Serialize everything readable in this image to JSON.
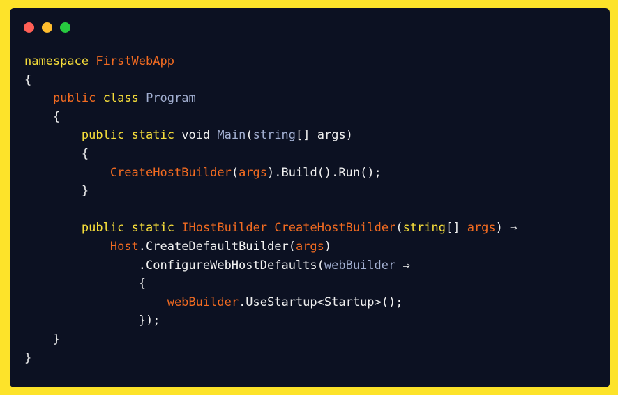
{
  "window": {
    "controls": [
      "close",
      "minimize",
      "maximize"
    ]
  },
  "colors": {
    "background": "#fde32a",
    "editor": "#0c1122",
    "keyword": "#f7de3a",
    "type": "#a3b0d2",
    "identifier": "#f26b21",
    "text": "#f0f0f0"
  },
  "code": {
    "lines": [
      [
        {
          "c": "kw",
          "t": "namespace"
        },
        {
          "c": "pl",
          "t": " "
        },
        {
          "c": "fn",
          "t": "FirstWebApp"
        }
      ],
      [
        {
          "c": "pl",
          "t": "{"
        }
      ],
      [
        {
          "c": "pl",
          "t": "    "
        },
        {
          "c": "fn",
          "t": "public"
        },
        {
          "c": "pl",
          "t": " "
        },
        {
          "c": "kw",
          "t": "class"
        },
        {
          "c": "pl",
          "t": " "
        },
        {
          "c": "ty",
          "t": "Program"
        }
      ],
      [
        {
          "c": "pl",
          "t": "    {"
        }
      ],
      [
        {
          "c": "pl",
          "t": "        "
        },
        {
          "c": "kw",
          "t": "public"
        },
        {
          "c": "pl",
          "t": " "
        },
        {
          "c": "kw",
          "t": "static"
        },
        {
          "c": "pl",
          "t": " void "
        },
        {
          "c": "ty",
          "t": "Main"
        },
        {
          "c": "pl",
          "t": "("
        },
        {
          "c": "ty",
          "t": "string"
        },
        {
          "c": "pl",
          "t": "[] args)"
        }
      ],
      [
        {
          "c": "pl",
          "t": "        {"
        }
      ],
      [
        {
          "c": "pl",
          "t": "            "
        },
        {
          "c": "fn",
          "t": "CreateHostBuilder"
        },
        {
          "c": "pl",
          "t": "("
        },
        {
          "c": "fn",
          "t": "args"
        },
        {
          "c": "pl",
          "t": ").Build().Run();"
        }
      ],
      [
        {
          "c": "pl",
          "t": "        }"
        }
      ],
      [
        {
          "c": "pl",
          "t": ""
        }
      ],
      [
        {
          "c": "pl",
          "t": "        "
        },
        {
          "c": "kw",
          "t": "public"
        },
        {
          "c": "pl",
          "t": " "
        },
        {
          "c": "kw",
          "t": "static"
        },
        {
          "c": "pl",
          "t": " "
        },
        {
          "c": "fn",
          "t": "IHostBuilder"
        },
        {
          "c": "pl",
          "t": " "
        },
        {
          "c": "fn",
          "t": "CreateHostBuilder"
        },
        {
          "c": "pl",
          "t": "("
        },
        {
          "c": "kw",
          "t": "string"
        },
        {
          "c": "pl",
          "t": "[] "
        },
        {
          "c": "fn",
          "t": "args"
        },
        {
          "c": "pl",
          "t": ") ⇒"
        }
      ],
      [
        {
          "c": "pl",
          "t": "            "
        },
        {
          "c": "fn",
          "t": "Host"
        },
        {
          "c": "pl",
          "t": ".CreateDefaultBuilder("
        },
        {
          "c": "fn",
          "t": "args"
        },
        {
          "c": "pl",
          "t": ")"
        }
      ],
      [
        {
          "c": "pl",
          "t": "                .ConfigureWebHostDefaults("
        },
        {
          "c": "ty",
          "t": "webBuilder"
        },
        {
          "c": "pl",
          "t": " ⇒"
        }
      ],
      [
        {
          "c": "pl",
          "t": "                {"
        }
      ],
      [
        {
          "c": "pl",
          "t": "                    "
        },
        {
          "c": "fn",
          "t": "webBuilder"
        },
        {
          "c": "pl",
          "t": ".UseStartup<Startup>();"
        }
      ],
      [
        {
          "c": "pl",
          "t": "                });"
        }
      ],
      [
        {
          "c": "pl",
          "t": "    }"
        }
      ],
      [
        {
          "c": "pl",
          "t": "}"
        }
      ]
    ]
  }
}
